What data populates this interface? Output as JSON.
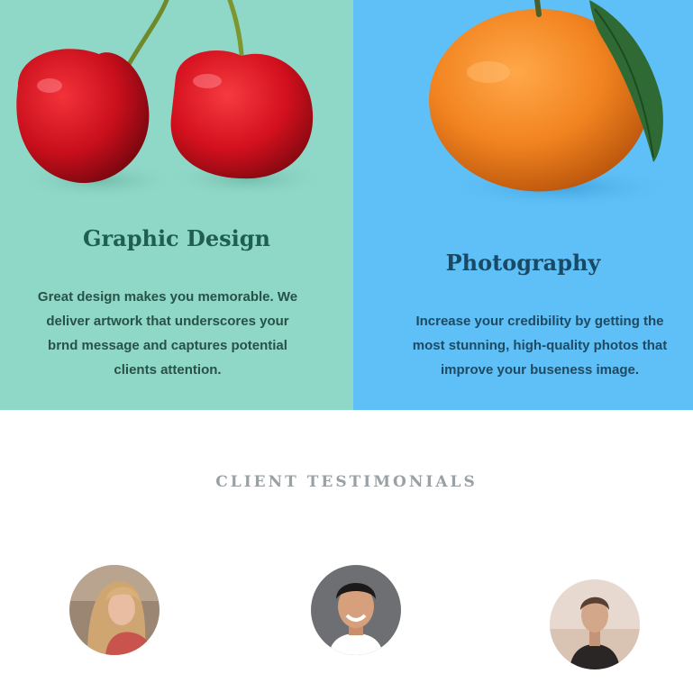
{
  "services": {
    "graphic_design": {
      "title": "Graphic Design",
      "description": "Great design makes you memorable. We deliver artwork that underscores your brnd message and captures potential clients attention.",
      "image": "cherries-image",
      "background": "#8fd7c7"
    },
    "photography": {
      "title": "Photography",
      "description": "Increase your credibility by getting the most stunning, high-quality photos that improve your buseness image.",
      "image": "orange-image",
      "background": "#5ec0f6"
    }
  },
  "testimonials": {
    "heading": "CLIENT TESTIMONIALS",
    "clients": [
      {
        "avatar": "client-avatar-woman-blonde"
      },
      {
        "avatar": "client-avatar-man-smiling"
      },
      {
        "avatar": "client-avatar-woman-short-hair"
      }
    ]
  }
}
